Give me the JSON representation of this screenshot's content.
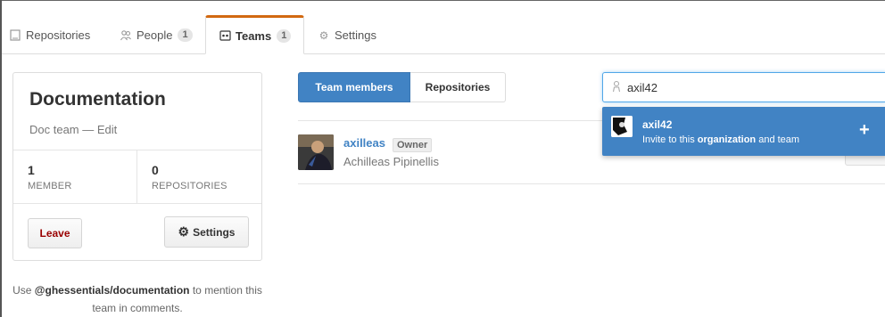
{
  "tabs": [
    {
      "label": "Repositories",
      "icon": "repo-icon"
    },
    {
      "label": "People",
      "icon": "people-icon",
      "count": "1"
    },
    {
      "label": "Teams",
      "icon": "teams-icon",
      "count": "1"
    },
    {
      "label": "Settings",
      "icon": "gear-icon"
    }
  ],
  "team": {
    "name": "Documentation",
    "description": "Doc team",
    "separator": " — ",
    "edit_label": "Edit",
    "stats": [
      {
        "value": "1",
        "label": "MEMBER"
      },
      {
        "value": "0",
        "label": "REPOSITORIES"
      }
    ],
    "leave_label": "Leave",
    "settings_label": "Settings",
    "mention_prefix": "Use ",
    "mention_handle": "@ghessentials/documentation",
    "mention_suffix": " to mention this team in comments."
  },
  "main": {
    "tabs": [
      {
        "label": "Team members"
      },
      {
        "label": "Repositories"
      }
    ],
    "members": [
      {
        "login": "axilleas",
        "badge": "Owner",
        "full_name": "Achilleas Pipinellis"
      }
    ]
  },
  "search": {
    "value": "axil42",
    "suggestion": {
      "login": "axil42",
      "invite_prefix": "Invite to this ",
      "invite_bold": "organization",
      "invite_suffix": " and team",
      "add_symbol": "+"
    }
  },
  "colors": {
    "accent": "#4183c4",
    "active_tab_border": "#d26911",
    "leave_text": "#990000"
  }
}
